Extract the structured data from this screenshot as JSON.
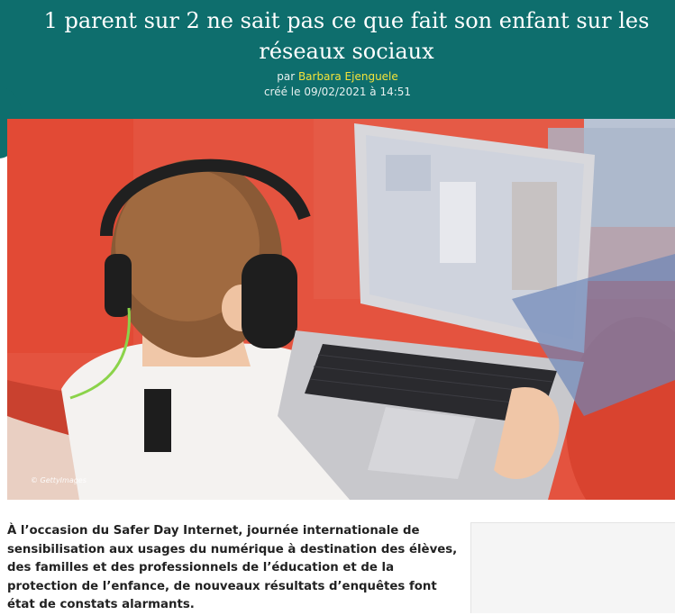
{
  "article": {
    "title": "1 parent sur 2 ne sait pas ce que fait son enfant sur les réseaux sociaux",
    "byline_prefix": "par",
    "author": "Barbara Ejenguele",
    "date_line": "créé le 09/02/2021 à 14:51",
    "image_credit": "© GettyImages",
    "lead_paragraph": "À l’occasion du Safer Day Internet, journée internationale de sensibilisation aux usages du numérique à destination des élèves, des familles et des professionnels de l’éducation et de la protection de l’enfance, de nouveaux résultats d’enquêtes font état de constats alarmants."
  },
  "colors": {
    "header_bg": "#0e6e6d",
    "author_link": "#f3e33a"
  }
}
